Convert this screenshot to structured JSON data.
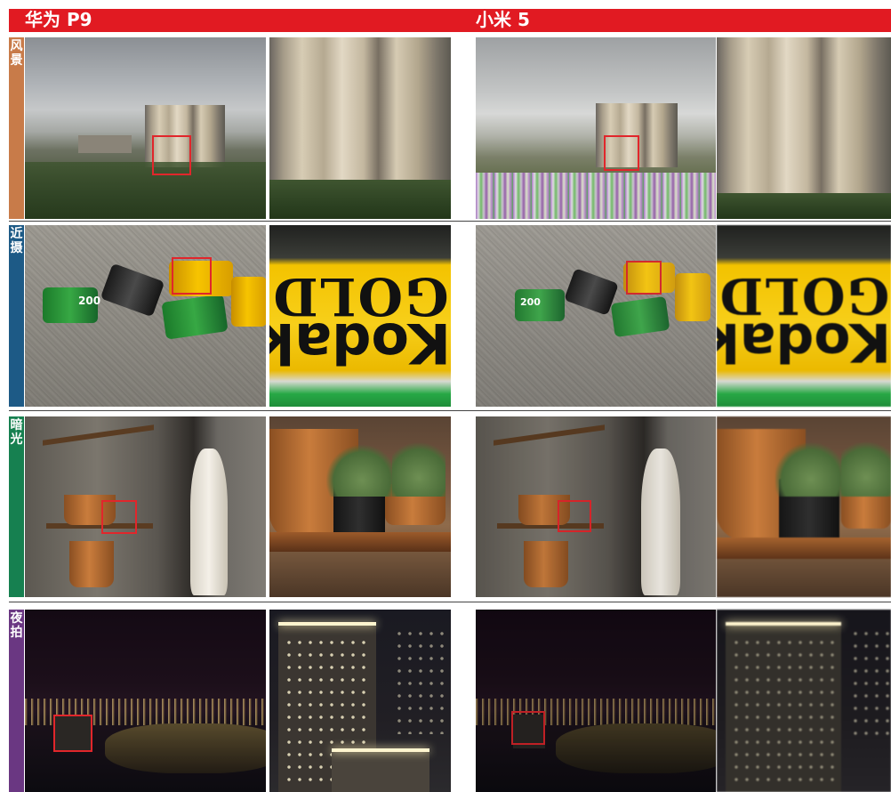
{
  "header": {
    "left_phone": "华为 P9",
    "right_phone": "小米 5",
    "bar_color": "#e11a22"
  },
  "categories": [
    {
      "id": "landscape",
      "label_line1": "风",
      "label_line2": "景",
      "color": "#c87b49"
    },
    {
      "id": "closeup",
      "label_line1": "近",
      "label_line2": "摄",
      "color": "#1d5a86"
    },
    {
      "id": "lowlight",
      "label_line1": "暗",
      "label_line2": "光",
      "color": "#168050"
    },
    {
      "id": "night",
      "label_line1": "夜",
      "label_line2": "拍",
      "color": "#6a3782"
    }
  ],
  "closeup_text": {
    "brand_word": "Kodak",
    "film_word": "GOLD",
    "film_speed": "200"
  },
  "roi_color": "#e1262b"
}
